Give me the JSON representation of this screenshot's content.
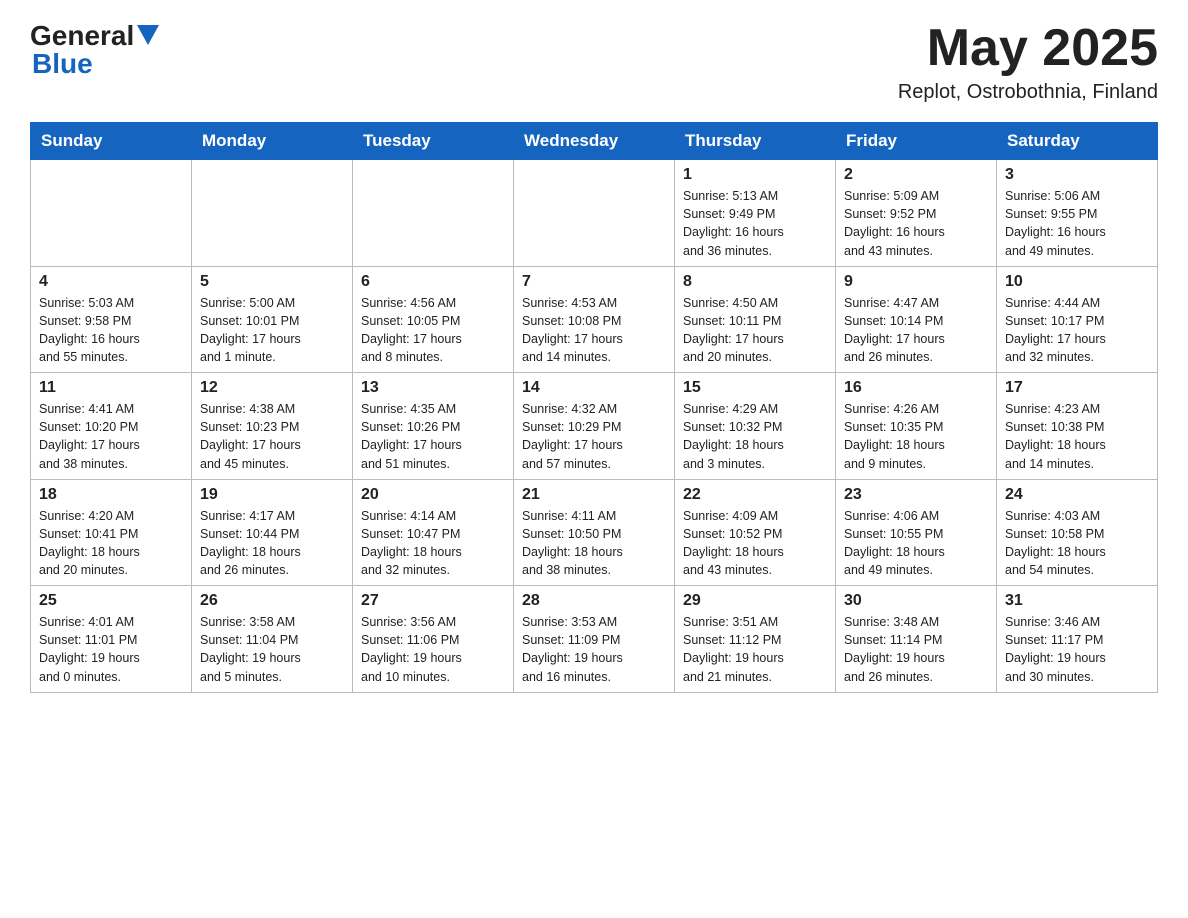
{
  "header": {
    "month_year": "May 2025",
    "location": "Replot, Ostrobothnia, Finland",
    "logo_line1": "General",
    "logo_line2": "Blue"
  },
  "weekdays": [
    "Sunday",
    "Monday",
    "Tuesday",
    "Wednesday",
    "Thursday",
    "Friday",
    "Saturday"
  ],
  "weeks": [
    [
      {
        "day": "",
        "info": ""
      },
      {
        "day": "",
        "info": ""
      },
      {
        "day": "",
        "info": ""
      },
      {
        "day": "",
        "info": ""
      },
      {
        "day": "1",
        "info": "Sunrise: 5:13 AM\nSunset: 9:49 PM\nDaylight: 16 hours\nand 36 minutes."
      },
      {
        "day": "2",
        "info": "Sunrise: 5:09 AM\nSunset: 9:52 PM\nDaylight: 16 hours\nand 43 minutes."
      },
      {
        "day": "3",
        "info": "Sunrise: 5:06 AM\nSunset: 9:55 PM\nDaylight: 16 hours\nand 49 minutes."
      }
    ],
    [
      {
        "day": "4",
        "info": "Sunrise: 5:03 AM\nSunset: 9:58 PM\nDaylight: 16 hours\nand 55 minutes."
      },
      {
        "day": "5",
        "info": "Sunrise: 5:00 AM\nSunset: 10:01 PM\nDaylight: 17 hours\nand 1 minute."
      },
      {
        "day": "6",
        "info": "Sunrise: 4:56 AM\nSunset: 10:05 PM\nDaylight: 17 hours\nand 8 minutes."
      },
      {
        "day": "7",
        "info": "Sunrise: 4:53 AM\nSunset: 10:08 PM\nDaylight: 17 hours\nand 14 minutes."
      },
      {
        "day": "8",
        "info": "Sunrise: 4:50 AM\nSunset: 10:11 PM\nDaylight: 17 hours\nand 20 minutes."
      },
      {
        "day": "9",
        "info": "Sunrise: 4:47 AM\nSunset: 10:14 PM\nDaylight: 17 hours\nand 26 minutes."
      },
      {
        "day": "10",
        "info": "Sunrise: 4:44 AM\nSunset: 10:17 PM\nDaylight: 17 hours\nand 32 minutes."
      }
    ],
    [
      {
        "day": "11",
        "info": "Sunrise: 4:41 AM\nSunset: 10:20 PM\nDaylight: 17 hours\nand 38 minutes."
      },
      {
        "day": "12",
        "info": "Sunrise: 4:38 AM\nSunset: 10:23 PM\nDaylight: 17 hours\nand 45 minutes."
      },
      {
        "day": "13",
        "info": "Sunrise: 4:35 AM\nSunset: 10:26 PM\nDaylight: 17 hours\nand 51 minutes."
      },
      {
        "day": "14",
        "info": "Sunrise: 4:32 AM\nSunset: 10:29 PM\nDaylight: 17 hours\nand 57 minutes."
      },
      {
        "day": "15",
        "info": "Sunrise: 4:29 AM\nSunset: 10:32 PM\nDaylight: 18 hours\nand 3 minutes."
      },
      {
        "day": "16",
        "info": "Sunrise: 4:26 AM\nSunset: 10:35 PM\nDaylight: 18 hours\nand 9 minutes."
      },
      {
        "day": "17",
        "info": "Sunrise: 4:23 AM\nSunset: 10:38 PM\nDaylight: 18 hours\nand 14 minutes."
      }
    ],
    [
      {
        "day": "18",
        "info": "Sunrise: 4:20 AM\nSunset: 10:41 PM\nDaylight: 18 hours\nand 20 minutes."
      },
      {
        "day": "19",
        "info": "Sunrise: 4:17 AM\nSunset: 10:44 PM\nDaylight: 18 hours\nand 26 minutes."
      },
      {
        "day": "20",
        "info": "Sunrise: 4:14 AM\nSunset: 10:47 PM\nDaylight: 18 hours\nand 32 minutes."
      },
      {
        "day": "21",
        "info": "Sunrise: 4:11 AM\nSunset: 10:50 PM\nDaylight: 18 hours\nand 38 minutes."
      },
      {
        "day": "22",
        "info": "Sunrise: 4:09 AM\nSunset: 10:52 PM\nDaylight: 18 hours\nand 43 minutes."
      },
      {
        "day": "23",
        "info": "Sunrise: 4:06 AM\nSunset: 10:55 PM\nDaylight: 18 hours\nand 49 minutes."
      },
      {
        "day": "24",
        "info": "Sunrise: 4:03 AM\nSunset: 10:58 PM\nDaylight: 18 hours\nand 54 minutes."
      }
    ],
    [
      {
        "day": "25",
        "info": "Sunrise: 4:01 AM\nSunset: 11:01 PM\nDaylight: 19 hours\nand 0 minutes."
      },
      {
        "day": "26",
        "info": "Sunrise: 3:58 AM\nSunset: 11:04 PM\nDaylight: 19 hours\nand 5 minutes."
      },
      {
        "day": "27",
        "info": "Sunrise: 3:56 AM\nSunset: 11:06 PM\nDaylight: 19 hours\nand 10 minutes."
      },
      {
        "day": "28",
        "info": "Sunrise: 3:53 AM\nSunset: 11:09 PM\nDaylight: 19 hours\nand 16 minutes."
      },
      {
        "day": "29",
        "info": "Sunrise: 3:51 AM\nSunset: 11:12 PM\nDaylight: 19 hours\nand 21 minutes."
      },
      {
        "day": "30",
        "info": "Sunrise: 3:48 AM\nSunset: 11:14 PM\nDaylight: 19 hours\nand 26 minutes."
      },
      {
        "day": "31",
        "info": "Sunrise: 3:46 AM\nSunset: 11:17 PM\nDaylight: 19 hours\nand 30 minutes."
      }
    ]
  ]
}
